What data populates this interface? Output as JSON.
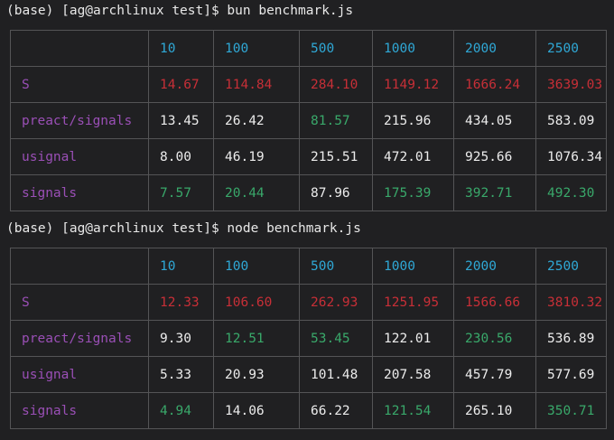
{
  "terminal": {
    "prompt_1": "(base) [ag@archlinux test]$ bun benchmark.js",
    "prompt_2": "(base) [ag@archlinux test]$ node benchmark.js"
  },
  "colors": {
    "background": "#202022",
    "header": "#2fa8d6",
    "library": "#9a4fb6",
    "slow": "#c72f37",
    "fast": "#39a86a",
    "normal": "#ececec",
    "border": "#545456"
  },
  "tables": [
    {
      "runtime": "bun",
      "headers": [
        "",
        "10",
        "100",
        "500",
        "1000",
        "2000",
        "2500"
      ],
      "rows": [
        {
          "lib": "S",
          "cells": [
            {
              "v": "14.67",
              "c": "red"
            },
            {
              "v": "114.84",
              "c": "red"
            },
            {
              "v": "284.10",
              "c": "red"
            },
            {
              "v": "1149.12",
              "c": "red"
            },
            {
              "v": "1666.24",
              "c": "red"
            },
            {
              "v": "3639.03",
              "c": "red"
            }
          ]
        },
        {
          "lib": "preact/signals",
          "cells": [
            {
              "v": "13.45",
              "c": "white"
            },
            {
              "v": "26.42",
              "c": "white"
            },
            {
              "v": "81.57",
              "c": "green"
            },
            {
              "v": "215.96",
              "c": "white"
            },
            {
              "v": "434.05",
              "c": "white"
            },
            {
              "v": "583.09",
              "c": "white"
            }
          ]
        },
        {
          "lib": "usignal",
          "cells": [
            {
              "v": "8.00",
              "c": "white"
            },
            {
              "v": "46.19",
              "c": "white"
            },
            {
              "v": "215.51",
              "c": "white"
            },
            {
              "v": "472.01",
              "c": "white"
            },
            {
              "v": "925.66",
              "c": "white"
            },
            {
              "v": "1076.34",
              "c": "white"
            }
          ]
        },
        {
          "lib": "signals",
          "cells": [
            {
              "v": "7.57",
              "c": "green"
            },
            {
              "v": "20.44",
              "c": "green"
            },
            {
              "v": "87.96",
              "c": "white"
            },
            {
              "v": "175.39",
              "c": "green"
            },
            {
              "v": "392.71",
              "c": "green"
            },
            {
              "v": "492.30",
              "c": "green"
            }
          ]
        }
      ]
    },
    {
      "runtime": "node",
      "headers": [
        "",
        "10",
        "100",
        "500",
        "1000",
        "2000",
        "2500"
      ],
      "rows": [
        {
          "lib": "S",
          "cells": [
            {
              "v": "12.33",
              "c": "red"
            },
            {
              "v": "106.60",
              "c": "red"
            },
            {
              "v": "262.93",
              "c": "red"
            },
            {
              "v": "1251.95",
              "c": "red"
            },
            {
              "v": "1566.66",
              "c": "red"
            },
            {
              "v": "3810.32",
              "c": "red"
            }
          ]
        },
        {
          "lib": "preact/signals",
          "cells": [
            {
              "v": "9.30",
              "c": "white"
            },
            {
              "v": "12.51",
              "c": "green"
            },
            {
              "v": "53.45",
              "c": "green"
            },
            {
              "v": "122.01",
              "c": "white"
            },
            {
              "v": "230.56",
              "c": "green"
            },
            {
              "v": "536.89",
              "c": "white"
            }
          ]
        },
        {
          "lib": "usignal",
          "cells": [
            {
              "v": "5.33",
              "c": "white"
            },
            {
              "v": "20.93",
              "c": "white"
            },
            {
              "v": "101.48",
              "c": "white"
            },
            {
              "v": "207.58",
              "c": "white"
            },
            {
              "v": "457.79",
              "c": "white"
            },
            {
              "v": "577.69",
              "c": "white"
            }
          ]
        },
        {
          "lib": "signals",
          "cells": [
            {
              "v": "4.94",
              "c": "green"
            },
            {
              "v": "14.06",
              "c": "white"
            },
            {
              "v": "66.22",
              "c": "white"
            },
            {
              "v": "121.54",
              "c": "green"
            },
            {
              "v": "265.10",
              "c": "white"
            },
            {
              "v": "350.71",
              "c": "green"
            }
          ]
        }
      ]
    }
  ]
}
